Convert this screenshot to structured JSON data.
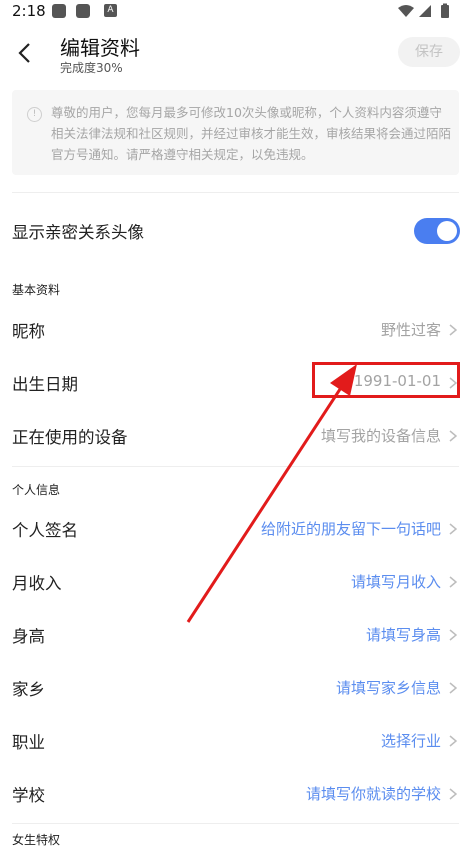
{
  "status_bar": {
    "time": "2:18",
    "a_icon_text": "A"
  },
  "header": {
    "title": "编辑资料",
    "subtitle": "完成度30%",
    "save_label": "保存"
  },
  "notice": {
    "text": "尊敬的用户，您每月最多可修改10次头像或昵称，个人资料内容须遵守相关法律法规和社区规则，并经过审核才能生效，审核结果将会通过陌陌官方号通知。请严格遵守相关规定，以免违规。"
  },
  "intimacy": {
    "label": "显示亲密关系头像",
    "enabled": true
  },
  "basic": {
    "section_title": "基本资料",
    "nickname": {
      "label": "昵称",
      "value": "野性过客"
    },
    "birthday": {
      "label": "出生日期",
      "value": "1991-01-01"
    },
    "device": {
      "label": "正在使用的设备",
      "value": "填写我的设备信息"
    }
  },
  "personal": {
    "section_title": "个人信息",
    "signature": {
      "label": "个人签名",
      "value": "给附近的朋友留下一句话吧"
    },
    "income": {
      "label": "月收入",
      "value": "请填写月收入"
    },
    "height": {
      "label": "身高",
      "value": "请填写身高"
    },
    "hometown": {
      "label": "家乡",
      "value": "请填写家乡信息"
    },
    "job": {
      "label": "职业",
      "value": "选择行业"
    },
    "school": {
      "label": "学校",
      "value": "请填写你就读的学校"
    }
  },
  "female_section": {
    "section_title": "女生特权"
  },
  "colors": {
    "accent_blue": "#4a7ef0",
    "link_blue": "#5b8def",
    "annotation_red": "#e21b1b"
  }
}
